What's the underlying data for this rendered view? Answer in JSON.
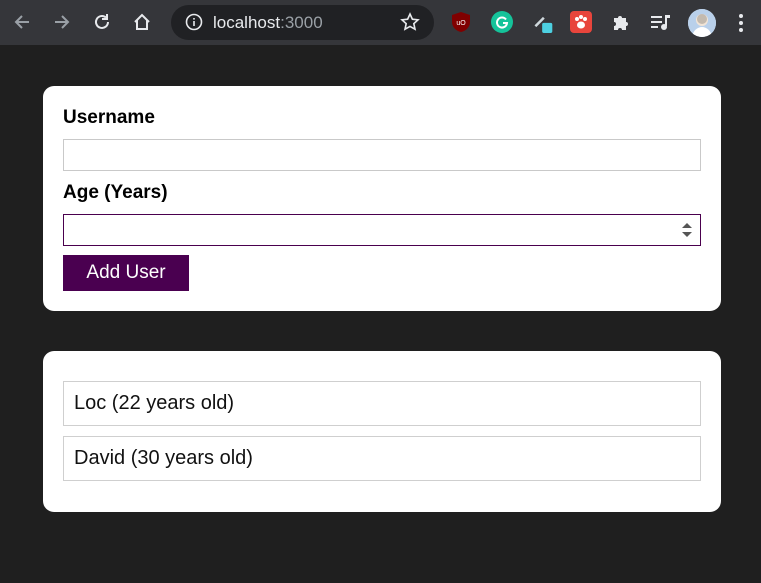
{
  "browser": {
    "url_host": "localhost",
    "url_port": ":3000"
  },
  "form": {
    "username_label": "Username",
    "username_value": "",
    "age_label": "Age (Years)",
    "age_value": "",
    "submit_label": "Add User"
  },
  "users": [
    {
      "text": "Loc (22 years old)"
    },
    {
      "text": "David (30 years old)"
    }
  ],
  "colors": {
    "page_bg": "#1f1f1f",
    "toolbar_bg": "#35363a",
    "accent": "#4a0050"
  }
}
